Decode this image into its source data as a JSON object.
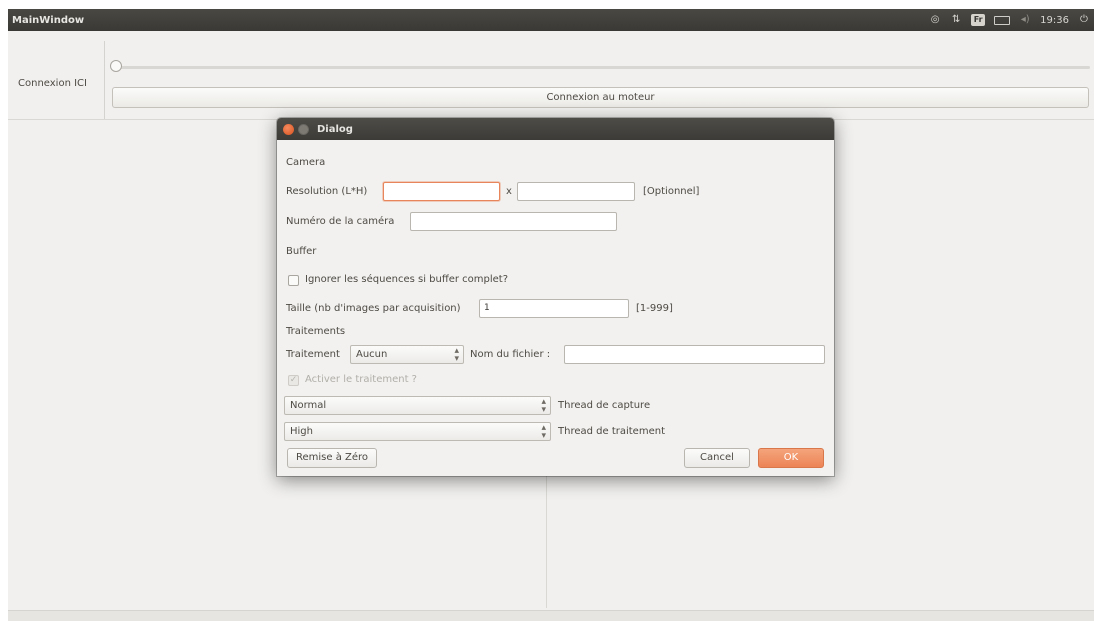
{
  "panel": {
    "title": "MainWindow",
    "keyboard_layout": "Fr",
    "clock": "19:36"
  },
  "main": {
    "connection_label": "Connexion ICI",
    "motor_button": "Connexion au moteur"
  },
  "dialog": {
    "title": "Dialog",
    "camera_section": "Camera",
    "resolution_label": "Resolution (L*H)",
    "resolution_width_value": "",
    "resolution_x": "x",
    "resolution_height_value": "",
    "optional_label": "[Optionnel]",
    "camera_number_label": "Numéro de la caméra",
    "camera_number_value": "",
    "buffer_section": "Buffer",
    "ignore_sequences_label": "Ignorer les séquences si buffer complet?",
    "ignore_sequences_checked": false,
    "size_label": "Taille (nb d'images par acquisition)",
    "size_value": "1",
    "size_range": "[1-999]",
    "processing_section": "Traitements",
    "processing_label": "Traitement",
    "processing_selected": "Aucun",
    "filename_label": "Nom du fichier :",
    "filename_value": "",
    "enable_processing_label": "Activer le traitement ?",
    "enable_processing_checked": true,
    "capture_priority_selected": "Normal",
    "capture_thread_label": "Thread de capture",
    "processing_priority_selected": "High",
    "processing_thread_label": "Thread de traitement",
    "reset_button": "Remise à Zéro",
    "cancel_button": "Cancel",
    "ok_button": "OK"
  },
  "colors": {
    "accent": "#ec8456",
    "panel_bg": "#3c3b37",
    "window_bg": "#f1f0ee"
  }
}
